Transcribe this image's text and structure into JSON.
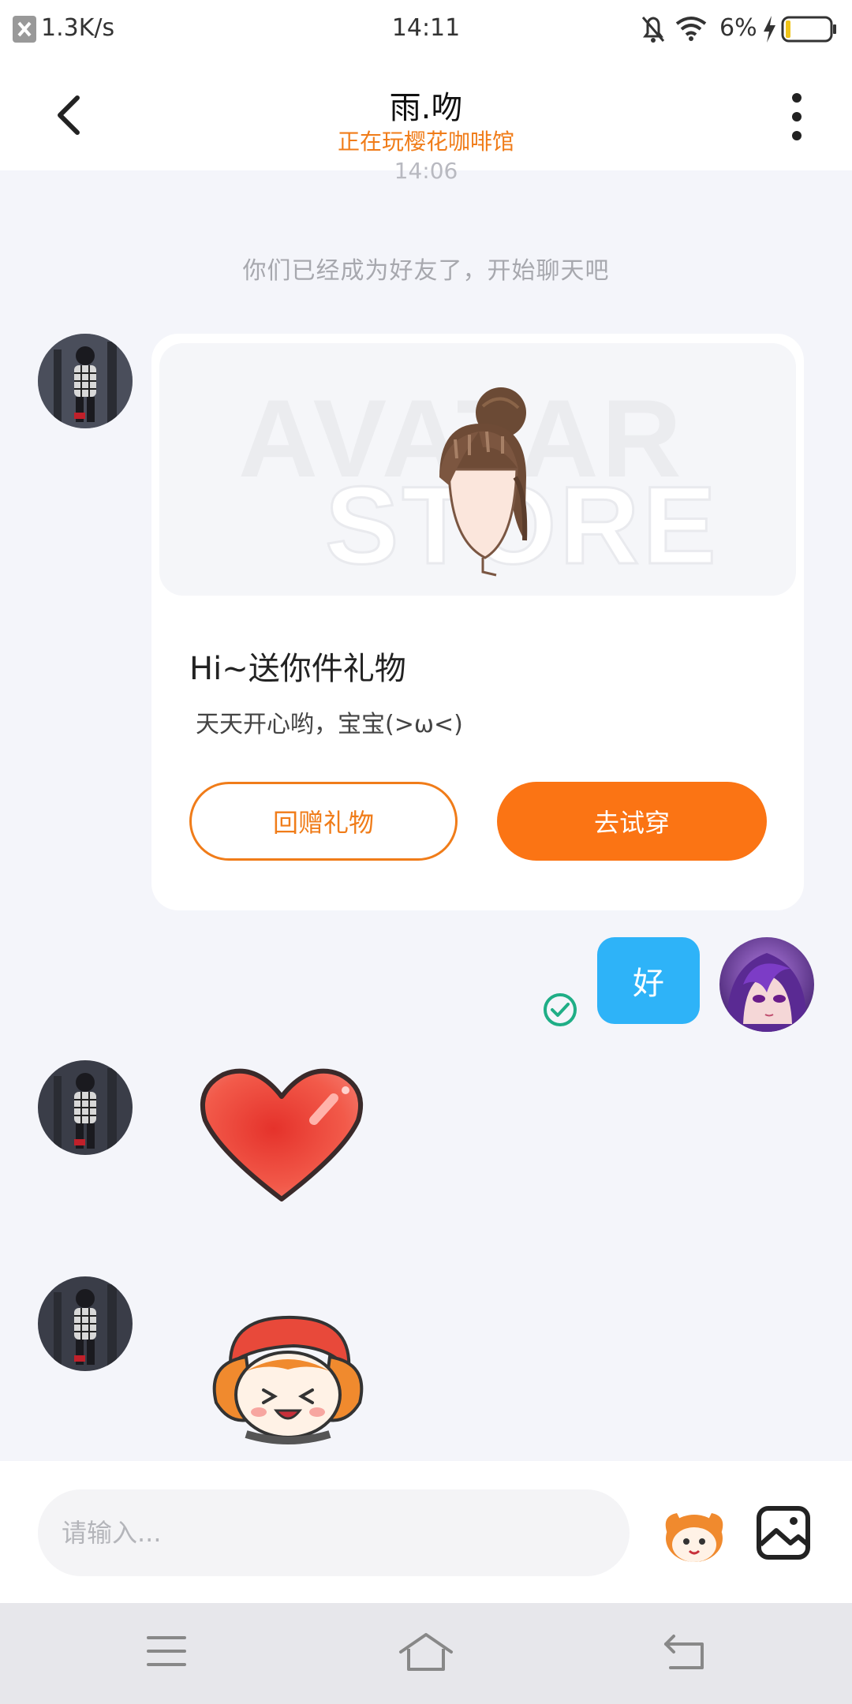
{
  "status_bar": {
    "speed": "1.3K/s",
    "time": "14:11",
    "battery": "6%",
    "icons": [
      "close-notification-icon",
      "mute-bell-icon",
      "wifi-icon",
      "charging-icon",
      "battery-icon"
    ]
  },
  "header": {
    "title": "雨.吻",
    "subtitle": "正在玩樱花咖啡馆"
  },
  "chat": {
    "time_label": "14:06",
    "system_message": "你们已经成为好友了，开始聊天吧",
    "gift_card": {
      "watermark_line1": "AVATAR",
      "watermark_line2": "STORE",
      "title": "Hi~送你件礼物",
      "description": "天天开心哟，宝宝(>ω<)",
      "return_gift_label": "回赠礼物",
      "try_on_label": "去试穿"
    },
    "my_message": "好"
  },
  "input": {
    "placeholder": "请输入..."
  },
  "colors": {
    "accent_orange": "#fb7414",
    "bubble_blue": "#2eb3f8",
    "read_green": "#1fae86"
  }
}
